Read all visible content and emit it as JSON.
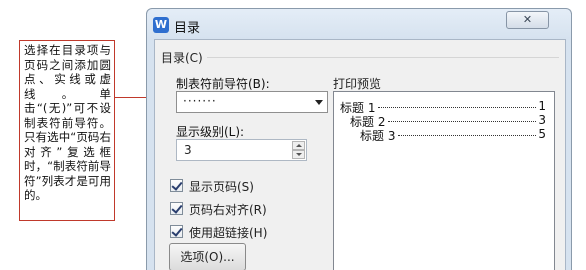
{
  "callout": {
    "text": "选择在目录项与页码之间添加圆点、实线或虚线。单击“(无)”可不设制表符前导符。只有选中“页码右对齐”复选框时，“制表符前导符”列表才是可用的。"
  },
  "dialog": {
    "title": "目录",
    "app_icon_glyph": "W",
    "close_label": "✕"
  },
  "group": {
    "label": "目录(C)"
  },
  "leader": {
    "label": "制表符前导符(B):",
    "value": "·······"
  },
  "levels": {
    "label": "显示级别(L):",
    "value": "3"
  },
  "checkboxes": [
    {
      "label": "显示页码(S)",
      "checked": true
    },
    {
      "label": "页码右对齐(R)",
      "checked": true
    },
    {
      "label": "使用超链接(H)",
      "checked": true
    }
  ],
  "options_button": {
    "label": "选项(O)..."
  },
  "preview": {
    "label": "打印预览",
    "rows": [
      {
        "text": "标题 1",
        "page": "1"
      },
      {
        "text": "标题 2",
        "page": "3"
      },
      {
        "text": "标题 3",
        "page": "5"
      }
    ]
  }
}
